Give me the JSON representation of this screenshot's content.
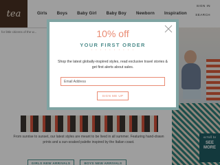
{
  "header": {
    "logo_text": "tea",
    "nav": [
      "Girls",
      "Boys",
      "Baby Girl",
      "Baby Boy",
      "Newborn",
      "Inspiration"
    ],
    "sign_in": "SIGN IN",
    "search": "SEARCH"
  },
  "page": {
    "tagline": "for little citizens of the w...",
    "intro_text": "From sunrise to sunset, our latest styles are meant to be lived in all summer. Featuring hand-drawn prints and a sun-soaked palette inspired by the Italian coast.",
    "shop_girls": "GIRLS NEW ARRIVALS",
    "shop_boys": "BOYS NEW ARRIVALS",
    "promo_script": "scroll to",
    "promo_cta": "SEE\nMORE"
  },
  "modal": {
    "headline": "10% off",
    "subheadline": "YOUR FIRST ORDER",
    "dots": "· · · · · · · · · ·",
    "body": "Shop the latest globally-inspired styles, read exclusive travel stories & get first alerts about sales.",
    "email_placeholder": "Email Address",
    "submit_label": "SIGN ME UP"
  },
  "colors": {
    "modal_border": "#7fa3a2",
    "accent_coral": "#e98a72",
    "accent_teal": "#4d8c8b",
    "logo_bg": "#4a3122"
  }
}
